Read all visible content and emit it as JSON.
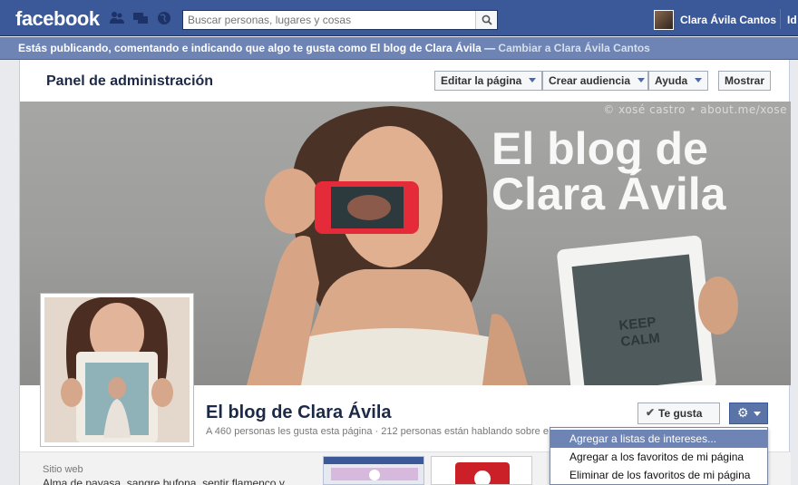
{
  "topbar": {
    "logo": "facebook",
    "search_placeholder": "Buscar personas, lugares y cosas",
    "user_name": "Clara Ávila Cantos",
    "extra_link": "Id"
  },
  "voice": {
    "text": "Estás publicando, comentando e indicando que algo te gusta como El blog de Clara Ávila — ",
    "link": "Cambiar a Clara Ávila Cantos"
  },
  "admin": {
    "title": "Panel de administración",
    "buttons": [
      "Editar la página",
      "Crear audiencia",
      "Ayuda",
      "Mostrar"
    ]
  },
  "cover": {
    "credit": "© xosé castro • about.me/xose",
    "title": "El blog de Clara Ávila"
  },
  "page": {
    "name": "El blog de Clara Ávila",
    "stats": "A 460 personas les gusta esta página · 212 personas están hablando sobre esto",
    "like_label": "Te gusta"
  },
  "menu": {
    "items": [
      "Agregar a listas de intereses...",
      "Agregar a los favoritos de mi página",
      "Eliminar de los favoritos de mi página"
    ]
  },
  "about": {
    "label": "Sitio web",
    "text": "Alma de payasa, sangre bufona, sentir flamenco y..."
  },
  "colors": {
    "brand_blue": "#3b5998",
    "voice_bar": "#6d84b4",
    "menu_highlight": "#6d84b4"
  }
}
